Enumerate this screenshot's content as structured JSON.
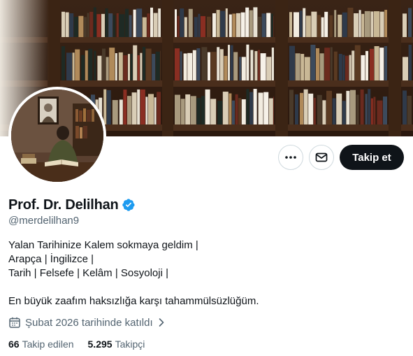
{
  "profile": {
    "display_name": "Prof. Dr. Delilhan",
    "verified": true,
    "handle": "@merdelilhan9",
    "bio_lines": [
      "Yalan Tarihinize Kalem sokmaya geldim |",
      "Arapça | İngilizce |",
      "Tarih | Felsefe | Kelâm | Sosyoloji |",
      "",
      "En büyük zaafım haksızlığa karşı tahammülsüzlüğüm."
    ],
    "joined": "Şubat 2026 tarihinde katıldı",
    "following_count": "66",
    "following_label": "Takip edilen",
    "followers_count": "5.295",
    "followers_label": "Takipçi"
  },
  "actions": {
    "follow_label": "Takip et",
    "more_icon": "more-horizontal-icon",
    "message_icon": "mail-icon"
  },
  "icons": {
    "verified": "verified-badge-icon",
    "calendar": "calendar-icon",
    "chevron": "chevron-right-icon"
  },
  "colors": {
    "verified_blue": "#1d9bf0",
    "text_primary": "#0f1419",
    "text_secondary": "#536471",
    "follow_bg": "#0f1419",
    "border": "#cfd9de"
  },
  "images": {
    "banner": "library bookshelves",
    "avatar": "man reading book in study with portrait on wall"
  }
}
